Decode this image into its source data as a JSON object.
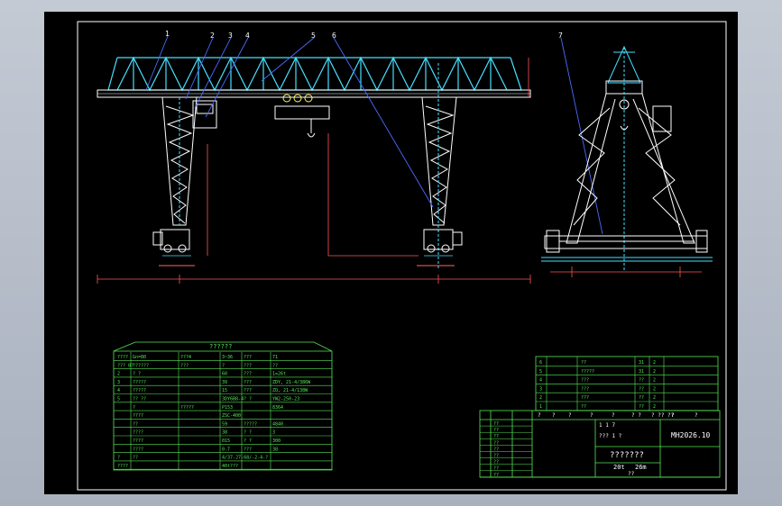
{
  "drawing": {
    "number": "MH2026.10",
    "spec_capacity": "20t",
    "spec_span": "26m",
    "name_placeholder": "???????",
    "footer_placeholder": "??",
    "leader_labels": [
      "1",
      "2",
      "3",
      "4",
      "5",
      "6",
      "7"
    ]
  },
  "param_table": {
    "title": "??????",
    "rows": [
      [
        "????",
        "Gn=80",
        "???4",
        "3~36",
        "???",
        "71"
      ],
      [
        "??? 0?",
        "??????",
        "???",
        "?",
        "???",
        "??"
      ],
      [
        "2",
        "? ?",
        "",
        "60",
        "???",
        "1=26t"
      ],
      [
        "3",
        "?????",
        "",
        "39",
        "???",
        "ZDY, 21-4/386W"
      ],
      [
        "4",
        "?????",
        "",
        "15",
        "???",
        "ZQ, 21-4/138W"
      ],
      [
        "5",
        "?? ??",
        "",
        "3DY6B8-4",
        "? ?",
        "YW2-250-23"
      ],
      [
        "",
        "?",
        "?????",
        "P153",
        "",
        "8364"
      ],
      [
        "",
        "????",
        "",
        "ZSC-400",
        "",
        ""
      ],
      [
        "",
        "??",
        "",
        "59",
        "?????",
        "4840"
      ],
      [
        "",
        "????",
        "",
        "38",
        "? ?",
        "3"
      ],
      [
        "",
        "????",
        "",
        "015",
        "? ?",
        "300"
      ],
      [
        "",
        "????",
        "",
        "0.7",
        "???",
        "38"
      ],
      [
        "?",
        "??",
        "",
        "4/37-J7-68/-2-4-?",
        "",
        ""
      ],
      [
        "????",
        "",
        "",
        "40t???",
        "",
        ""
      ]
    ]
  },
  "parts_list": {
    "rows": [
      [
        "6",
        "??",
        "31",
        "2"
      ],
      [
        "5",
        "?????",
        "31",
        "2"
      ],
      [
        "4",
        "???",
        "??",
        "2"
      ],
      [
        "3",
        "???",
        "??",
        "2"
      ],
      [
        "2",
        "???",
        "??",
        "2"
      ],
      [
        "1",
        "??",
        "??",
        "2"
      ]
    ],
    "header": [
      "?",
      "?",
      "?",
      "?",
      "?",
      "? ?",
      "? ?? ??",
      "?",
      "?"
    ]
  },
  "title_block": {
    "left_rows": [
      "??",
      "??",
      "??",
      "??",
      "??",
      "??",
      "??",
      "??",
      "??"
    ],
    "scale_cells": [
      "1 1 7",
      "??? 1 ?"
    ]
  }
}
